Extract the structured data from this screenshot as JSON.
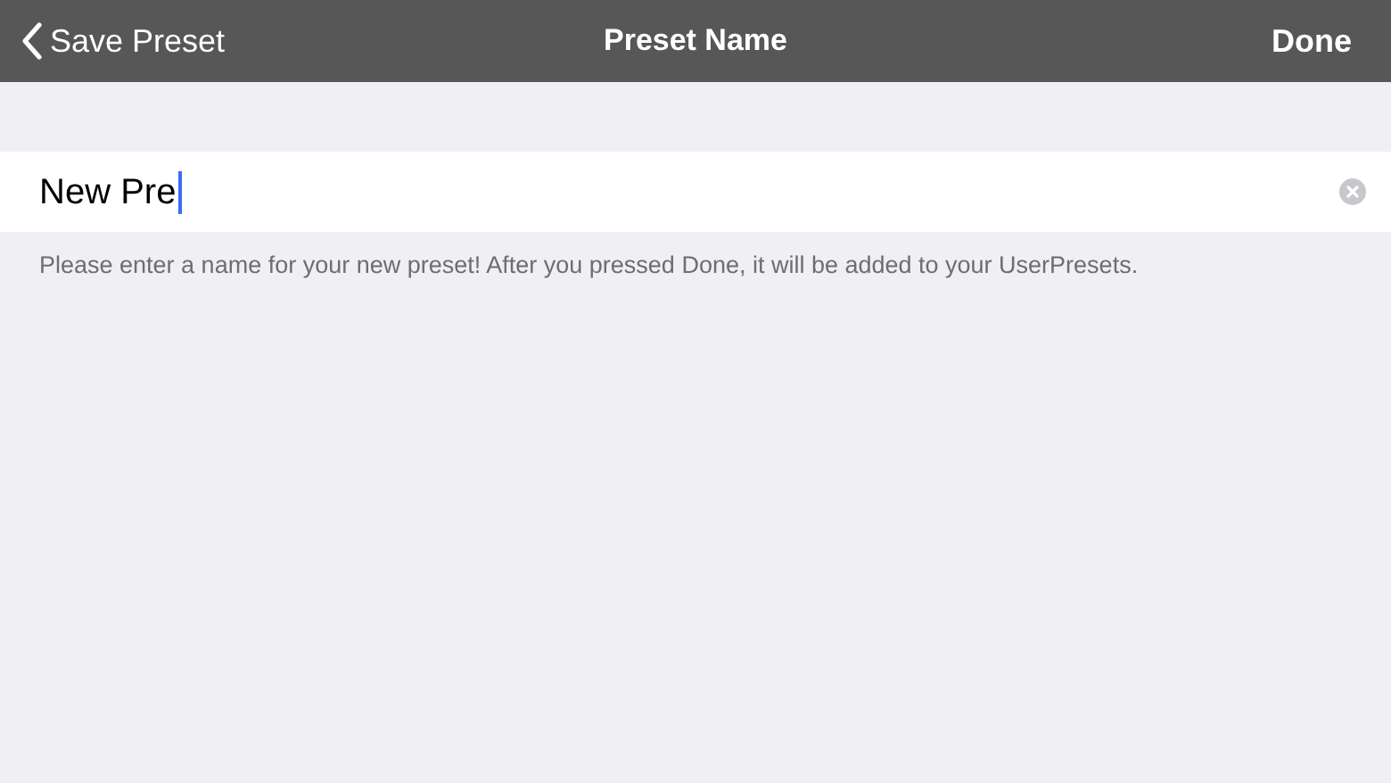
{
  "nav_bar": {
    "back_label": "Save Preset",
    "title": "Preset Name",
    "action": "Done"
  },
  "name_field": {
    "value": "New Pre",
    "focused": true
  },
  "hint": "Please enter a name for your new preset! After you pressed Done, it will be added to your UserPresets."
}
